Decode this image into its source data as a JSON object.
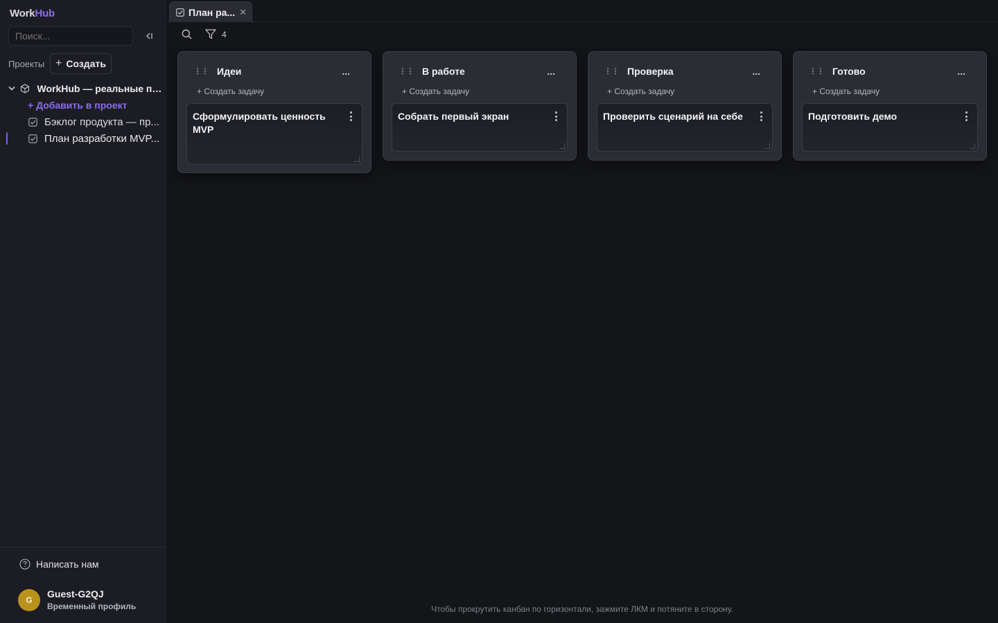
{
  "app": {
    "name_part1": "Work",
    "name_part2": "Hub",
    "accent": "#8b6cf0"
  },
  "sidebar": {
    "search_placeholder": "Поиск...",
    "projects_label": "Проекты",
    "create_label": "Создать",
    "project": {
      "title": "WorkHub — реальные при...",
      "add_label": "+ Добавить в проект"
    },
    "docs": [
      {
        "label": "Бэклог продукта — пр..."
      },
      {
        "label": "План разработки MVP..."
      }
    ],
    "help_label": "Написать нам",
    "user": {
      "initial": "G",
      "name": "Guest-G2QJ",
      "subtitle": "Временный профиль"
    }
  },
  "tabs": [
    {
      "label": "План ра..."
    }
  ],
  "toolbar": {
    "filter_count": "4"
  },
  "board": {
    "add_task_label": "+ Создать задачу",
    "columns": [
      {
        "title": "Идеи",
        "menu": "...",
        "cards": [
          {
            "title": "Сформулировать ценность MVP"
          }
        ]
      },
      {
        "title": "В работе",
        "menu": "...",
        "cards": [
          {
            "title": "Собрать первый экран"
          }
        ]
      },
      {
        "title": "Проверка",
        "menu": "...",
        "cards": [
          {
            "title": "Проверить сценарий на себе"
          }
        ]
      },
      {
        "title": "Готово",
        "menu": "...",
        "cards": [
          {
            "title": "Подготовить демо"
          }
        ]
      }
    ]
  },
  "hint": "Чтобы прокрутить канбан по горизонтали, зажмите ЛКМ и потяните в сторону."
}
